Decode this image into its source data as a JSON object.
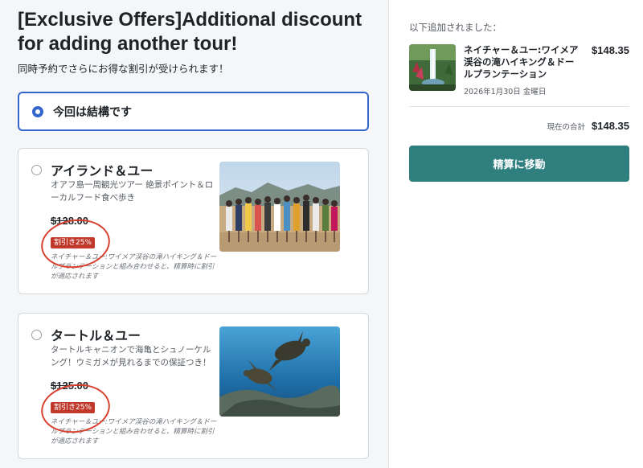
{
  "header": {
    "headline": "[Exclusive Offers]Additional discount for adding another tour!",
    "subline": "同時予約でさらにお得な割引が受けられます！"
  },
  "options": {
    "none_label": "今回は結構です",
    "tours": [
      {
        "title": "アイランド＆ユー",
        "description": "オアフ島一周観光ツアー 絶景ポイント＆ローカルフード食べ歩き",
        "price": "$128.00",
        "badge": "割引き25%",
        "note": "ネイチャー＆ユー:ワイメア渓谷の滝ハイキング＆ドールプランテーションと組み合わせると、精算時に割引が適応されます",
        "image_icon": "group-photo-image"
      },
      {
        "title": "タートル＆ユー",
        "description": "タートルキャニオンで海亀とシュノーケルング！ウミガメが見れるまでの保証つき！",
        "price": "$125.00",
        "badge": "割引き25%",
        "note": "ネイチャー＆ユー:ワイメア渓谷の滝ハイキング＆ドールプランテーションと組み合わせると、精算時に割引が適応されます",
        "image_icon": "sea-turtle-image"
      }
    ]
  },
  "cart": {
    "added_label": "以下追加されました：",
    "item": {
      "name": "ネイチャー＆ユー:ワイメア渓谷の滝ハイキング＆ドールプランテーション",
      "price": "$148.35",
      "date": "2026年1月30日 金曜日",
      "image_icon": "waterfall-image"
    },
    "total_label": "現在の合計",
    "total_value": "$148.35",
    "checkout_label": "精算に移動"
  },
  "colors": {
    "accent_blue": "#3366cc",
    "checkout_teal": "#2f7f7f",
    "badge_red": "#c0392b",
    "annotation_red": "#d8402f"
  }
}
